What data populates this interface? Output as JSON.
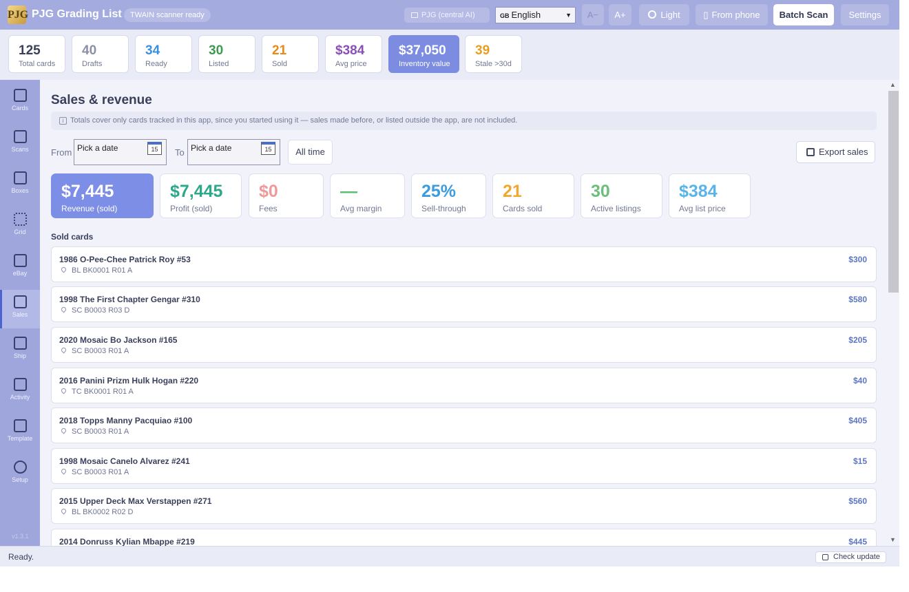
{
  "header": {
    "logo_text": "PJG",
    "title": "PJG Grading List",
    "scanner_status": "TWAIN scanner ready",
    "ai_mode": "PJG (central AI)",
    "language": "English",
    "language_flag": "GB",
    "font_smaller": "A−",
    "font_larger": "A+",
    "theme_label": "Light",
    "from_phone_label": "From phone",
    "batch_scan_label": "Batch Scan",
    "settings_label": "Settings"
  },
  "stats": [
    {
      "value": "125",
      "label": "Total cards",
      "color": "#3a3f5a"
    },
    {
      "value": "40",
      "label": "Drafts",
      "color": "#8a8fa6"
    },
    {
      "value": "34",
      "label": "Ready",
      "color": "#3b8fe0"
    },
    {
      "value": "30",
      "label": "Listed",
      "color": "#3d9a4f"
    },
    {
      "value": "21",
      "label": "Sold",
      "color": "#e68a1a"
    },
    {
      "value": "$384",
      "label": "Avg price",
      "color": "#8a4fb8"
    },
    {
      "value": "$37,050",
      "label": "Inventory value",
      "color": "#ffffff"
    },
    {
      "value": "39",
      "label": "Stale >30d",
      "color": "#e6a020"
    }
  ],
  "sidebar": {
    "items": [
      {
        "label": "Cards",
        "icon": "cards-icon"
      },
      {
        "label": "Scans",
        "icon": "camera-icon"
      },
      {
        "label": "Boxes",
        "icon": "box-icon"
      },
      {
        "label": "Grid",
        "icon": "grid-icon"
      },
      {
        "label": "eBay",
        "icon": "tag-icon"
      },
      {
        "label": "Sales",
        "icon": "sales-icon"
      },
      {
        "label": "Ship",
        "icon": "truck-icon"
      },
      {
        "label": "Activity",
        "icon": "clipboard-icon"
      },
      {
        "label": "Template",
        "icon": "puzzle-icon"
      },
      {
        "label": "Setup",
        "icon": "gear-icon"
      }
    ],
    "active": "Sales",
    "version": "v1.3.1"
  },
  "main": {
    "title": "Sales & revenue",
    "info_note": "Totals cover only cards tracked in this app, since you started using it — sales made before, or listed outside the app, are not included.",
    "from_label": "From",
    "to_label": "To",
    "from_placeholder": "Pick a date",
    "to_placeholder": "Pick a date",
    "calendar_day": "15",
    "all_time_label": "All time",
    "export_label": "Export sales",
    "kpis": [
      {
        "value": "$7,445",
        "label": "Revenue (sold)",
        "color": "#ffffff"
      },
      {
        "value": "$7,445",
        "label": "Profit (sold)",
        "color": "#2ea88a"
      },
      {
        "value": "$0",
        "label": "Fees",
        "color": "#ef9a9a"
      },
      {
        "value": "—",
        "label": "Avg margin",
        "color": "#5bbf72"
      },
      {
        "value": "25%",
        "label": "Sell-through",
        "color": "#3b9de0"
      },
      {
        "value": "21",
        "label": "Cards sold",
        "color": "#f0a830"
      },
      {
        "value": "30",
        "label": "Active listings",
        "color": "#6cbf7a"
      },
      {
        "value": "$384",
        "label": "Avg list price",
        "color": "#5ab4e8"
      }
    ],
    "sold_title": "Sold cards",
    "sold_cards": [
      {
        "name": "1986 O-Pee-Chee Patrick Roy #53",
        "location": "BL BK0001 R01 A",
        "price": "$300"
      },
      {
        "name": "1998 The First Chapter Gengar #310",
        "location": "SC B0003 R03 D",
        "price": "$580"
      },
      {
        "name": "2020 Mosaic Bo Jackson #165",
        "location": "SC B0003 R01 A",
        "price": "$205"
      },
      {
        "name": "2016 Panini Prizm Hulk Hogan #220",
        "location": "TC BK0001 R01 A",
        "price": "$40"
      },
      {
        "name": "2018 Topps Manny Pacquiao #100",
        "location": "SC B0003 R01 A",
        "price": "$405"
      },
      {
        "name": "1998 Mosaic Canelo Alvarez #241",
        "location": "SC B0003 R01 A",
        "price": "$15"
      },
      {
        "name": "2015 Upper Deck Max Verstappen #271",
        "location": "BL BK0002 R02 D",
        "price": "$560"
      },
      {
        "name": "2014 Donruss Kylian Mbappe #219",
        "location": "",
        "price": "$445"
      }
    ]
  },
  "statusbar": {
    "status": "Ready.",
    "check_update_label": "Check update"
  }
}
